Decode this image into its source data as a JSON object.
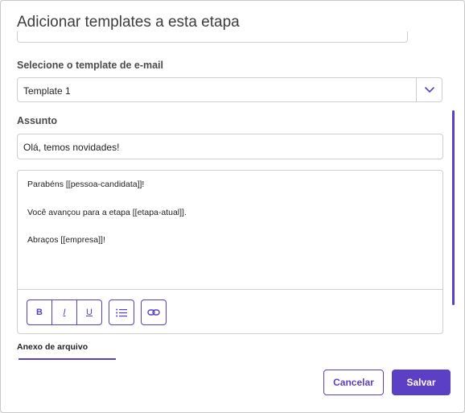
{
  "modal": {
    "title": "Adicionar templates a esta etapa"
  },
  "template_select": {
    "label": "Selecione o template de e-mail",
    "value": "Template 1"
  },
  "subject": {
    "label": "Assunto",
    "value": "Olá, temos novidades!"
  },
  "editor": {
    "lines": [
      "Parabéns [[pessoa-candidata]]!",
      "Você avançou para a etapa [[etapa-atual]].",
      "Abraços [[empresa]]!"
    ],
    "toolbar": {
      "bold": "B",
      "italic": "I",
      "underline": "U"
    }
  },
  "attachment": {
    "label": "Anexo de arquivo"
  },
  "actions": {
    "cancel": "Cancelar",
    "save": "Salvar"
  },
  "colors": {
    "accent": "#5b3fc4",
    "border": "#cfcfcf"
  }
}
